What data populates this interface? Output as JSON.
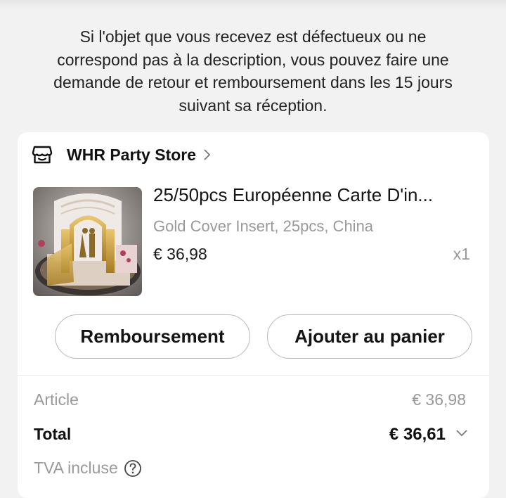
{
  "notice": {
    "lines": [
      "Si l'objet que vous recevez est défectueux ou ne",
      "correspond pas à la description, vous pouvez faire une",
      "demande de retour et remboursement dans les 15 jours",
      "suivant sa réception."
    ]
  },
  "store": {
    "icon": "store-icon",
    "name": "WHR Party Store"
  },
  "product": {
    "title": "25/50pcs Européenne Carte D'in...",
    "variant": "Gold Cover Insert, 25pcs, China",
    "price": "€ 36,98",
    "quantity": "x1"
  },
  "actions": {
    "refund_label": "Remboursement",
    "add_to_cart_label": "Ajouter au panier"
  },
  "summary": {
    "article_label": "Article",
    "article_value": "€ 36,98",
    "total_label": "Total",
    "total_value": "€ 36,61",
    "tva_label": "TVA incluse"
  },
  "colors": {
    "background": "#f2f2f2",
    "card": "#ffffff",
    "muted_text": "#9a9a9a",
    "button_border": "#b9b9b9"
  }
}
